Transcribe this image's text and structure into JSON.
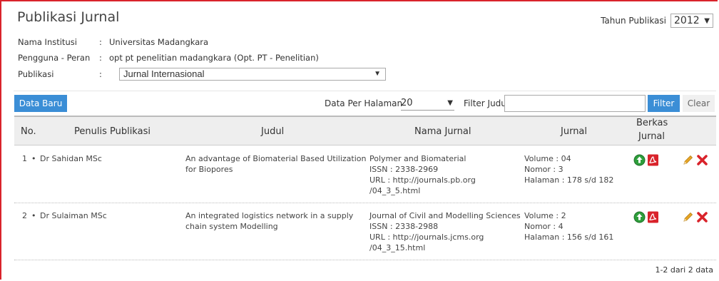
{
  "page_title": "Publikasi Jurnal",
  "tahun": {
    "label": "Tahun Publikasi",
    "value": "2012"
  },
  "info": {
    "institusi_label": "Nama Institusi",
    "institusi_value": "Universitas Madangkara",
    "pengguna_label": "Pengguna - Peran",
    "pengguna_value": "opt pt penelitian madangkara (Opt. PT - Penelitian)",
    "publikasi_label": "Publikasi",
    "publikasi_value": "Jurnal Internasional",
    "colon": ":"
  },
  "toolbar": {
    "new_label": "Data Baru",
    "per_page_label": "Data Per Halaman",
    "per_page_value": "20",
    "filter_label": "Filter Judul",
    "filter_value": "",
    "filter_button": "Filter",
    "clear_button": "Clear"
  },
  "table": {
    "headers": {
      "no": "No.",
      "penulis": "Penulis Publikasi",
      "judul": "Judul",
      "nama_jurnal": "Nama Jurnal",
      "jurnal": "Jurnal",
      "berkas_1": "Berkas",
      "berkas_2": "Jurnal"
    },
    "rows": [
      {
        "no": "1",
        "penulis": "Dr Sahidan MSc",
        "judul_1": "An advantage of Biomaterial Based Utilization",
        "judul_2": "for Biopores",
        "jurnal_name": "Polymer and Biomaterial",
        "issn": "ISSN : 2338-2969",
        "url_1": "URL : http://journals.pb.org",
        "url_2": "/04_3_5.html",
        "volume": "Volume : 04",
        "nomor": "Nomor : 3",
        "halaman": "Halaman : 178 s/d 182"
      },
      {
        "no": "2",
        "penulis": "Dr Sulaiman MSc",
        "judul_1": "An integrated logistics network in a supply",
        "judul_2": "chain system Modelling",
        "jurnal_name": "Journal of Civil and Modelling Sciences",
        "issn": "ISSN : 2338-2988",
        "url_1": "URL : http://journals.jcms.org",
        "url_2": "/04_3_15.html",
        "volume": "Volume : 2",
        "nomor": "Nomor : 4",
        "halaman": "Halaman : 156 s/d 161"
      }
    ]
  },
  "footer": {
    "summary": "1-2 dari 2 data"
  },
  "colors": {
    "accent": "#3b8ed6",
    "frame": "#d9232b",
    "delete": "#d9232b",
    "upload": "#2e9e3b",
    "pdf": "#d9232b",
    "edit": "#e8a626"
  }
}
